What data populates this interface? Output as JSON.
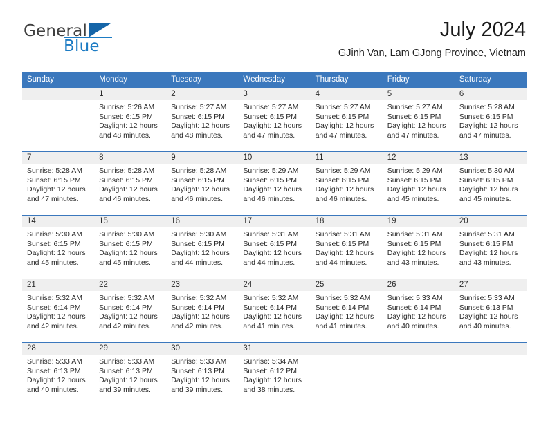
{
  "brand": {
    "name_top": "General",
    "name_bottom": "Blue",
    "accent_color": "#1d7cc4",
    "triangle_color": "#1565a8"
  },
  "header": {
    "title": "July 2024",
    "subtitle": "GJinh Van, Lam GJong Province, Vietnam"
  },
  "calendar": {
    "header_color": "#3b78bd",
    "daynum_band_color": "#efefef",
    "weekday_headers": [
      "Sunday",
      "Monday",
      "Tuesday",
      "Wednesday",
      "Thursday",
      "Friday",
      "Saturday"
    ],
    "weeks": [
      [
        {
          "day": "",
          "sunrise": "",
          "sunset": "",
          "daylight_line1": "",
          "daylight_line2": ""
        },
        {
          "day": "1",
          "sunrise": "Sunrise: 5:26 AM",
          "sunset": "Sunset: 6:15 PM",
          "daylight_line1": "Daylight: 12 hours",
          "daylight_line2": "and 48 minutes."
        },
        {
          "day": "2",
          "sunrise": "Sunrise: 5:27 AM",
          "sunset": "Sunset: 6:15 PM",
          "daylight_line1": "Daylight: 12 hours",
          "daylight_line2": "and 48 minutes."
        },
        {
          "day": "3",
          "sunrise": "Sunrise: 5:27 AM",
          "sunset": "Sunset: 6:15 PM",
          "daylight_line1": "Daylight: 12 hours",
          "daylight_line2": "and 47 minutes."
        },
        {
          "day": "4",
          "sunrise": "Sunrise: 5:27 AM",
          "sunset": "Sunset: 6:15 PM",
          "daylight_line1": "Daylight: 12 hours",
          "daylight_line2": "and 47 minutes."
        },
        {
          "day": "5",
          "sunrise": "Sunrise: 5:27 AM",
          "sunset": "Sunset: 6:15 PM",
          "daylight_line1": "Daylight: 12 hours",
          "daylight_line2": "and 47 minutes."
        },
        {
          "day": "6",
          "sunrise": "Sunrise: 5:28 AM",
          "sunset": "Sunset: 6:15 PM",
          "daylight_line1": "Daylight: 12 hours",
          "daylight_line2": "and 47 minutes."
        }
      ],
      [
        {
          "day": "7",
          "sunrise": "Sunrise: 5:28 AM",
          "sunset": "Sunset: 6:15 PM",
          "daylight_line1": "Daylight: 12 hours",
          "daylight_line2": "and 47 minutes."
        },
        {
          "day": "8",
          "sunrise": "Sunrise: 5:28 AM",
          "sunset": "Sunset: 6:15 PM",
          "daylight_line1": "Daylight: 12 hours",
          "daylight_line2": "and 46 minutes."
        },
        {
          "day": "9",
          "sunrise": "Sunrise: 5:28 AM",
          "sunset": "Sunset: 6:15 PM",
          "daylight_line1": "Daylight: 12 hours",
          "daylight_line2": "and 46 minutes."
        },
        {
          "day": "10",
          "sunrise": "Sunrise: 5:29 AM",
          "sunset": "Sunset: 6:15 PM",
          "daylight_line1": "Daylight: 12 hours",
          "daylight_line2": "and 46 minutes."
        },
        {
          "day": "11",
          "sunrise": "Sunrise: 5:29 AM",
          "sunset": "Sunset: 6:15 PM",
          "daylight_line1": "Daylight: 12 hours",
          "daylight_line2": "and 46 minutes."
        },
        {
          "day": "12",
          "sunrise": "Sunrise: 5:29 AM",
          "sunset": "Sunset: 6:15 PM",
          "daylight_line1": "Daylight: 12 hours",
          "daylight_line2": "and 45 minutes."
        },
        {
          "day": "13",
          "sunrise": "Sunrise: 5:30 AM",
          "sunset": "Sunset: 6:15 PM",
          "daylight_line1": "Daylight: 12 hours",
          "daylight_line2": "and 45 minutes."
        }
      ],
      [
        {
          "day": "14",
          "sunrise": "Sunrise: 5:30 AM",
          "sunset": "Sunset: 6:15 PM",
          "daylight_line1": "Daylight: 12 hours",
          "daylight_line2": "and 45 minutes."
        },
        {
          "day": "15",
          "sunrise": "Sunrise: 5:30 AM",
          "sunset": "Sunset: 6:15 PM",
          "daylight_line1": "Daylight: 12 hours",
          "daylight_line2": "and 45 minutes."
        },
        {
          "day": "16",
          "sunrise": "Sunrise: 5:30 AM",
          "sunset": "Sunset: 6:15 PM",
          "daylight_line1": "Daylight: 12 hours",
          "daylight_line2": "and 44 minutes."
        },
        {
          "day": "17",
          "sunrise": "Sunrise: 5:31 AM",
          "sunset": "Sunset: 6:15 PM",
          "daylight_line1": "Daylight: 12 hours",
          "daylight_line2": "and 44 minutes."
        },
        {
          "day": "18",
          "sunrise": "Sunrise: 5:31 AM",
          "sunset": "Sunset: 6:15 PM",
          "daylight_line1": "Daylight: 12 hours",
          "daylight_line2": "and 44 minutes."
        },
        {
          "day": "19",
          "sunrise": "Sunrise: 5:31 AM",
          "sunset": "Sunset: 6:15 PM",
          "daylight_line1": "Daylight: 12 hours",
          "daylight_line2": "and 43 minutes."
        },
        {
          "day": "20",
          "sunrise": "Sunrise: 5:31 AM",
          "sunset": "Sunset: 6:15 PM",
          "daylight_line1": "Daylight: 12 hours",
          "daylight_line2": "and 43 minutes."
        }
      ],
      [
        {
          "day": "21",
          "sunrise": "Sunrise: 5:32 AM",
          "sunset": "Sunset: 6:14 PM",
          "daylight_line1": "Daylight: 12 hours",
          "daylight_line2": "and 42 minutes."
        },
        {
          "day": "22",
          "sunrise": "Sunrise: 5:32 AM",
          "sunset": "Sunset: 6:14 PM",
          "daylight_line1": "Daylight: 12 hours",
          "daylight_line2": "and 42 minutes."
        },
        {
          "day": "23",
          "sunrise": "Sunrise: 5:32 AM",
          "sunset": "Sunset: 6:14 PM",
          "daylight_line1": "Daylight: 12 hours",
          "daylight_line2": "and 42 minutes."
        },
        {
          "day": "24",
          "sunrise": "Sunrise: 5:32 AM",
          "sunset": "Sunset: 6:14 PM",
          "daylight_line1": "Daylight: 12 hours",
          "daylight_line2": "and 41 minutes."
        },
        {
          "day": "25",
          "sunrise": "Sunrise: 5:32 AM",
          "sunset": "Sunset: 6:14 PM",
          "daylight_line1": "Daylight: 12 hours",
          "daylight_line2": "and 41 minutes."
        },
        {
          "day": "26",
          "sunrise": "Sunrise: 5:33 AM",
          "sunset": "Sunset: 6:14 PM",
          "daylight_line1": "Daylight: 12 hours",
          "daylight_line2": "and 40 minutes."
        },
        {
          "day": "27",
          "sunrise": "Sunrise: 5:33 AM",
          "sunset": "Sunset: 6:13 PM",
          "daylight_line1": "Daylight: 12 hours",
          "daylight_line2": "and 40 minutes."
        }
      ],
      [
        {
          "day": "28",
          "sunrise": "Sunrise: 5:33 AM",
          "sunset": "Sunset: 6:13 PM",
          "daylight_line1": "Daylight: 12 hours",
          "daylight_line2": "and 40 minutes."
        },
        {
          "day": "29",
          "sunrise": "Sunrise: 5:33 AM",
          "sunset": "Sunset: 6:13 PM",
          "daylight_line1": "Daylight: 12 hours",
          "daylight_line2": "and 39 minutes."
        },
        {
          "day": "30",
          "sunrise": "Sunrise: 5:33 AM",
          "sunset": "Sunset: 6:13 PM",
          "daylight_line1": "Daylight: 12 hours",
          "daylight_line2": "and 39 minutes."
        },
        {
          "day": "31",
          "sunrise": "Sunrise: 5:34 AM",
          "sunset": "Sunset: 6:12 PM",
          "daylight_line1": "Daylight: 12 hours",
          "daylight_line2": "and 38 minutes."
        },
        {
          "day": "",
          "sunrise": "",
          "sunset": "",
          "daylight_line1": "",
          "daylight_line2": ""
        },
        {
          "day": "",
          "sunrise": "",
          "sunset": "",
          "daylight_line1": "",
          "daylight_line2": ""
        },
        {
          "day": "",
          "sunrise": "",
          "sunset": "",
          "daylight_line1": "",
          "daylight_line2": ""
        }
      ]
    ]
  }
}
